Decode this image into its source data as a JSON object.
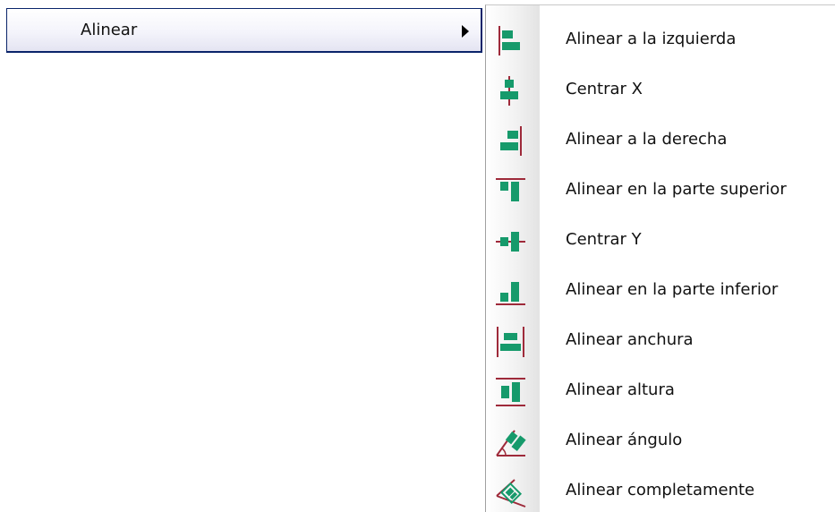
{
  "colors": {
    "icon_green": "#169a6b",
    "icon_green_dark": "#0f6e4c",
    "icon_guide": "#9e2a3a",
    "selection_border": "#0a246a"
  },
  "parent_menu_item": {
    "label": "Alinear",
    "submenu_arrow_icon": "submenu-arrow-icon"
  },
  "submenu": {
    "items": [
      {
        "label": "Alinear a la izquierda",
        "icon": "align-left-icon"
      },
      {
        "label": "Centrar X",
        "icon": "center-x-icon"
      },
      {
        "label": "Alinear a la derecha",
        "icon": "align-right-icon"
      },
      {
        "label": "Alinear en la parte superior",
        "icon": "align-top-icon"
      },
      {
        "label": "Centrar Y",
        "icon": "center-y-icon"
      },
      {
        "label": "Alinear en la parte inferior",
        "icon": "align-bottom-icon"
      },
      {
        "label": "Alinear anchura",
        "icon": "align-width-icon"
      },
      {
        "label": "Alinear altura",
        "icon": "align-height-icon"
      },
      {
        "label": "Alinear ángulo",
        "icon": "align-angle-icon"
      },
      {
        "label": "Alinear completamente",
        "icon": "align-fully-icon"
      }
    ]
  }
}
